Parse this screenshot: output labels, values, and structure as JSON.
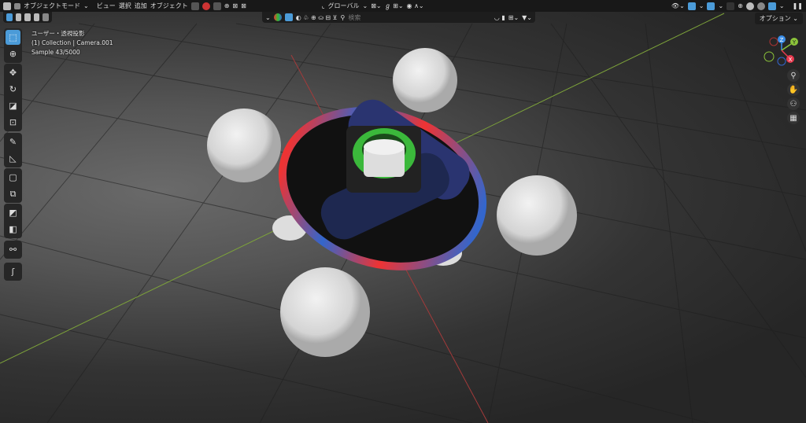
{
  "header": {
    "mode": "オブジェクトモード",
    "menus": [
      "ビュー",
      "選択",
      "追加",
      "オブジェクト"
    ],
    "orientation": "グローバル",
    "options": "オプション"
  },
  "outliner_search": {
    "placeholder": "検索"
  },
  "overlay_info": {
    "view": "ユーザー・透視投影",
    "collection": "(1) Collection | Camera.001",
    "sample": "Sample 43/5000"
  },
  "gizmo": {
    "axes": [
      "Z",
      "Y",
      "X"
    ],
    "colors": {
      "x": "#e83a4f",
      "y": "#8bc33a",
      "z": "#3a8ee8"
    }
  },
  "tools": [
    "select-box",
    "cursor",
    "move",
    "rotate",
    "scale",
    "transform",
    "annotate",
    "measure",
    "add-cube",
    "extrude",
    "shade",
    "loop-cut",
    "knife",
    "spin"
  ],
  "accent": "#4b9bd8"
}
